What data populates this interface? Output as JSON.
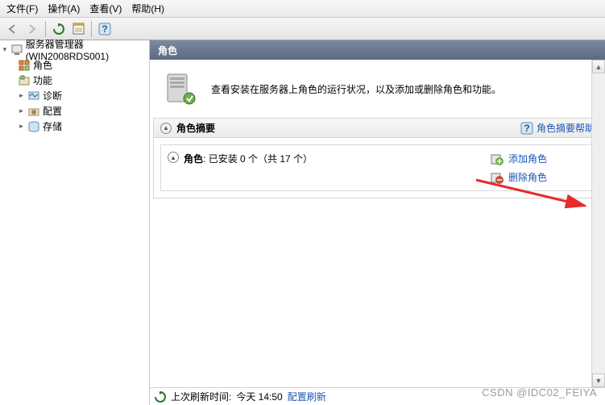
{
  "menu": {
    "file": "文件(F)",
    "action": "操作(A)",
    "view": "查看(V)",
    "help": "帮助(H)"
  },
  "tree": {
    "root": "服务器管理器 (WIN2008RDS001)",
    "roles": "角色",
    "features": "功能",
    "diagnostics": "诊断",
    "config": "配置",
    "storage": "存储"
  },
  "header": {
    "title": "角色"
  },
  "desc": "查看安装在服务器上角色的运行状况，以及添加或删除角色和功能。",
  "summary": {
    "title": "角色摘要",
    "help": "角色摘要帮助",
    "roles_label": "角色",
    "installed": "已安装 0 个（共 17 个）",
    "add": "添加角色",
    "remove": "删除角色"
  },
  "status": {
    "last_refresh_label": "上次刷新时间:",
    "last_refresh_time": "今天 14:50",
    "config_refresh": "配置刷新"
  },
  "watermark": "CSDN @IDC02_FEIYA"
}
